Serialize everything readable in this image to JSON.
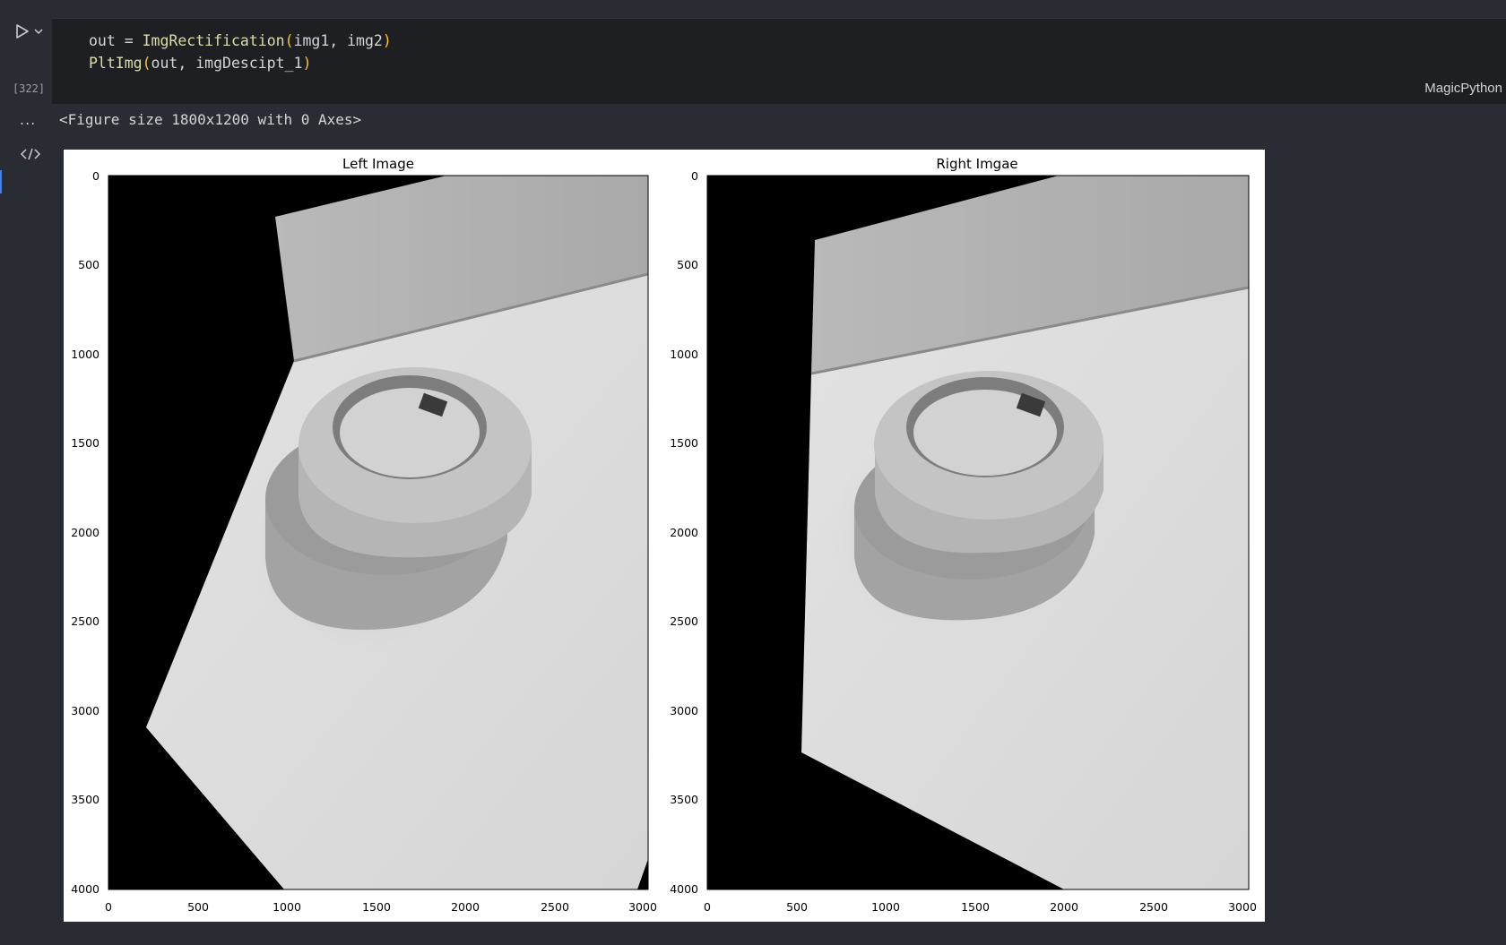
{
  "cell": {
    "execution_count": "[322]",
    "language": "MagicPython",
    "code": {
      "line1": {
        "var": "out",
        "op": " = ",
        "fn": "ImgRectification",
        "open": "(",
        "args": "img1, img2",
        "close": ")"
      },
      "line2": {
        "fn": "PltImg",
        "open": "(",
        "args": "out, imgDescipt_1",
        "close": ")"
      }
    }
  },
  "output": {
    "more_label": "...",
    "text": "<Figure size 1800x1200 with 0 Axes>"
  },
  "icons": {
    "run": "play-icon",
    "run_menu": "chevron-down-icon",
    "output_type": "code-icon"
  },
  "figure": {
    "panels": [
      {
        "title": "Left Image",
        "x_ticks": [
          "0",
          "500",
          "1000",
          "1500",
          "2000",
          "2500",
          "3000"
        ],
        "y_ticks": [
          "0",
          "500",
          "1000",
          "1500",
          "2000",
          "2500",
          "3000",
          "3500",
          "4000"
        ]
      },
      {
        "title": "Right Imgae",
        "x_ticks": [
          "0",
          "500",
          "1000",
          "1500",
          "2000",
          "2500",
          "3000"
        ],
        "y_ticks": [
          "0",
          "500",
          "1000",
          "1500",
          "2000",
          "2500",
          "3000",
          "3500",
          "4000"
        ]
      }
    ]
  },
  "colors": {
    "accent": "#3b82f6",
    "paren": "#f4c430",
    "editor_bg": "#1e1f22"
  }
}
